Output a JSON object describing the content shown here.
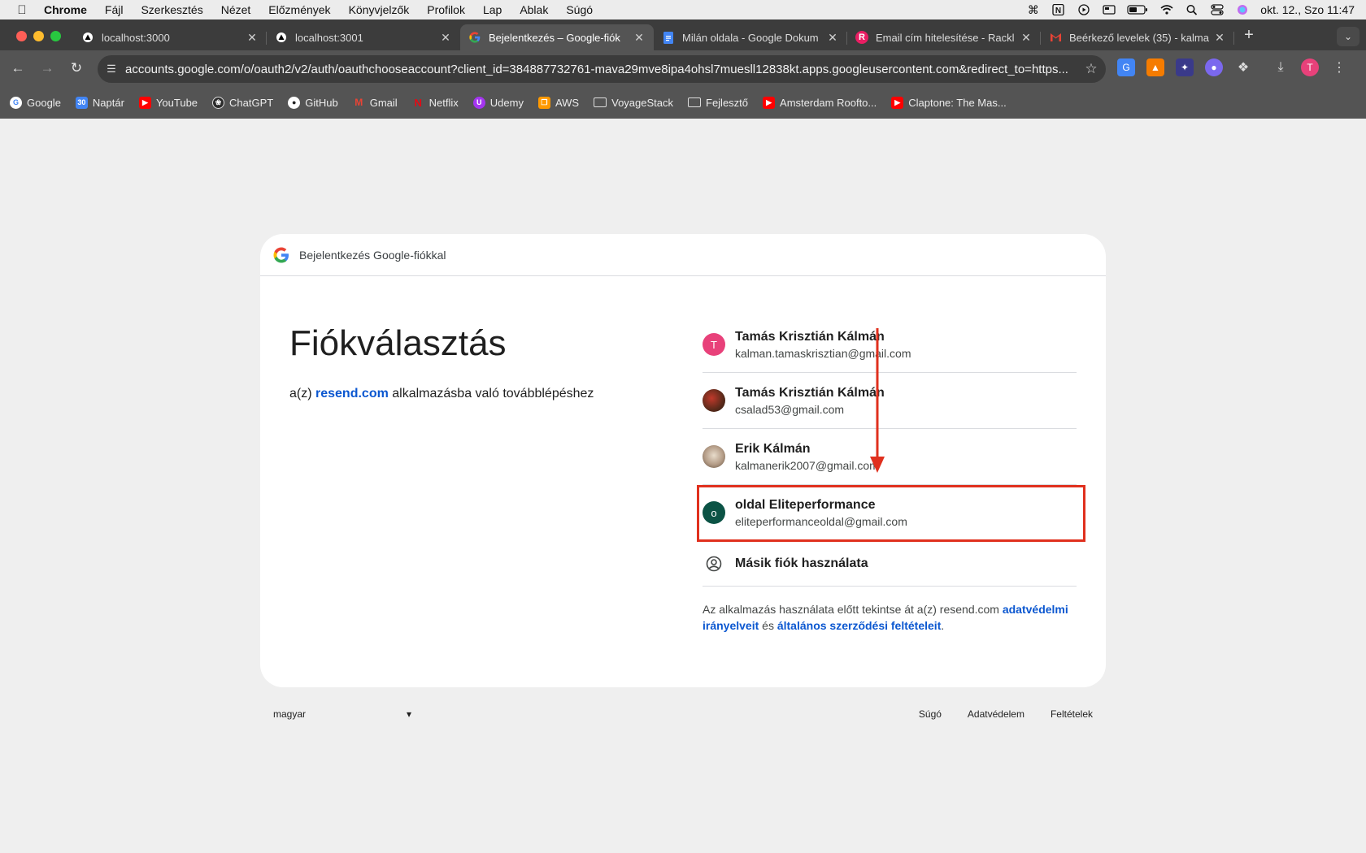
{
  "menubar": {
    "app": "Chrome",
    "items": [
      "Fájl",
      "Szerkesztés",
      "Nézet",
      "Előzmények",
      "Könyvjelzők",
      "Profilok",
      "Lap",
      "Ablak",
      "Súgó"
    ],
    "clock": "okt. 12., Szo  11:47"
  },
  "tabs": [
    {
      "title": "localhost:3000",
      "icon": "triangle-icon",
      "active": false
    },
    {
      "title": "localhost:3001",
      "icon": "triangle-icon",
      "active": false
    },
    {
      "title": "Bejelentkezés – Google-fiók",
      "icon": "google-icon",
      "active": true
    },
    {
      "title": "Milán oldala - Google Dokum",
      "icon": "docs-icon",
      "active": false
    },
    {
      "title": "Email cím hitelesítése - Rackl",
      "icon": "r-icon",
      "active": false
    },
    {
      "title": "Beérkező levelek (35) - kalma",
      "icon": "gmail-icon",
      "active": false
    }
  ],
  "address": {
    "url": "accounts.google.com/o/oauth2/v2/auth/oauthchooseaccount?client_id=384887732761-mava29mve8ipa4ohsl7muesll12838kt.apps.googleusercontent.com&redirect_to=https..."
  },
  "profile": {
    "initial": "T"
  },
  "bookmarks": [
    {
      "label": "Google",
      "color": "#ffffff"
    },
    {
      "label": "Naptár",
      "color": "#4285f4"
    },
    {
      "label": "YouTube",
      "color": "#ff0000"
    },
    {
      "label": "ChatGPT",
      "color": "#303030"
    },
    {
      "label": "GitHub",
      "color": "#303030"
    },
    {
      "label": "Gmail",
      "color": "#ea4335"
    },
    {
      "label": "Netflix",
      "color": "#e50914"
    },
    {
      "label": "Udemy",
      "color": "#a435f0"
    },
    {
      "label": "AWS",
      "color": "#ff9900"
    },
    {
      "label": "VoyageStack",
      "color": "folder"
    },
    {
      "label": "Fejlesztő",
      "color": "folder"
    },
    {
      "label": "Amsterdam Roofto...",
      "color": "#ff0000"
    },
    {
      "label": "Claptone: The Mas...",
      "color": "#ff0000"
    }
  ],
  "card": {
    "header": "Bejelentkezés Google-fiókkal",
    "title": "Fiókválasztás",
    "subtitle_prefix": "a(z) ",
    "subtitle_link": "resend.com",
    "subtitle_suffix": " alkalmazásba való továbblépéshez",
    "accounts": [
      {
        "name": "Tamás Krisztián Kálmán",
        "email": "kalman.tamaskrisztian@gmail.com",
        "initial": "T",
        "color": "#e8417a"
      },
      {
        "name": "Tamás Krisztián Kálmán",
        "email": "csalad53@gmail.com",
        "initial": "",
        "color": "#6b3a2a"
      },
      {
        "name": "Erik Kálmán",
        "email": "kalmanerik2007@gmail.com",
        "initial": "",
        "color": "#b39b86"
      },
      {
        "name": "oldal Eliteperformance",
        "email": "eliteperformanceoldal@gmail.com",
        "initial": "o",
        "color": "#0b5345"
      }
    ],
    "other_account": "Másik fiók használata",
    "legal_prefix": "Az alkalmazás használata előtt tekintse át a(z) resend.com ",
    "legal_link1": "adatvédelmi irányelveit",
    "legal_mid": " és ",
    "legal_link2": "általános szerződési feltételeit",
    "legal_suffix": "."
  },
  "footer": {
    "language": "magyar",
    "links": [
      "Súgó",
      "Adatvédelem",
      "Feltételek"
    ]
  },
  "annotation": {
    "highlight_color": "#e0301e"
  }
}
